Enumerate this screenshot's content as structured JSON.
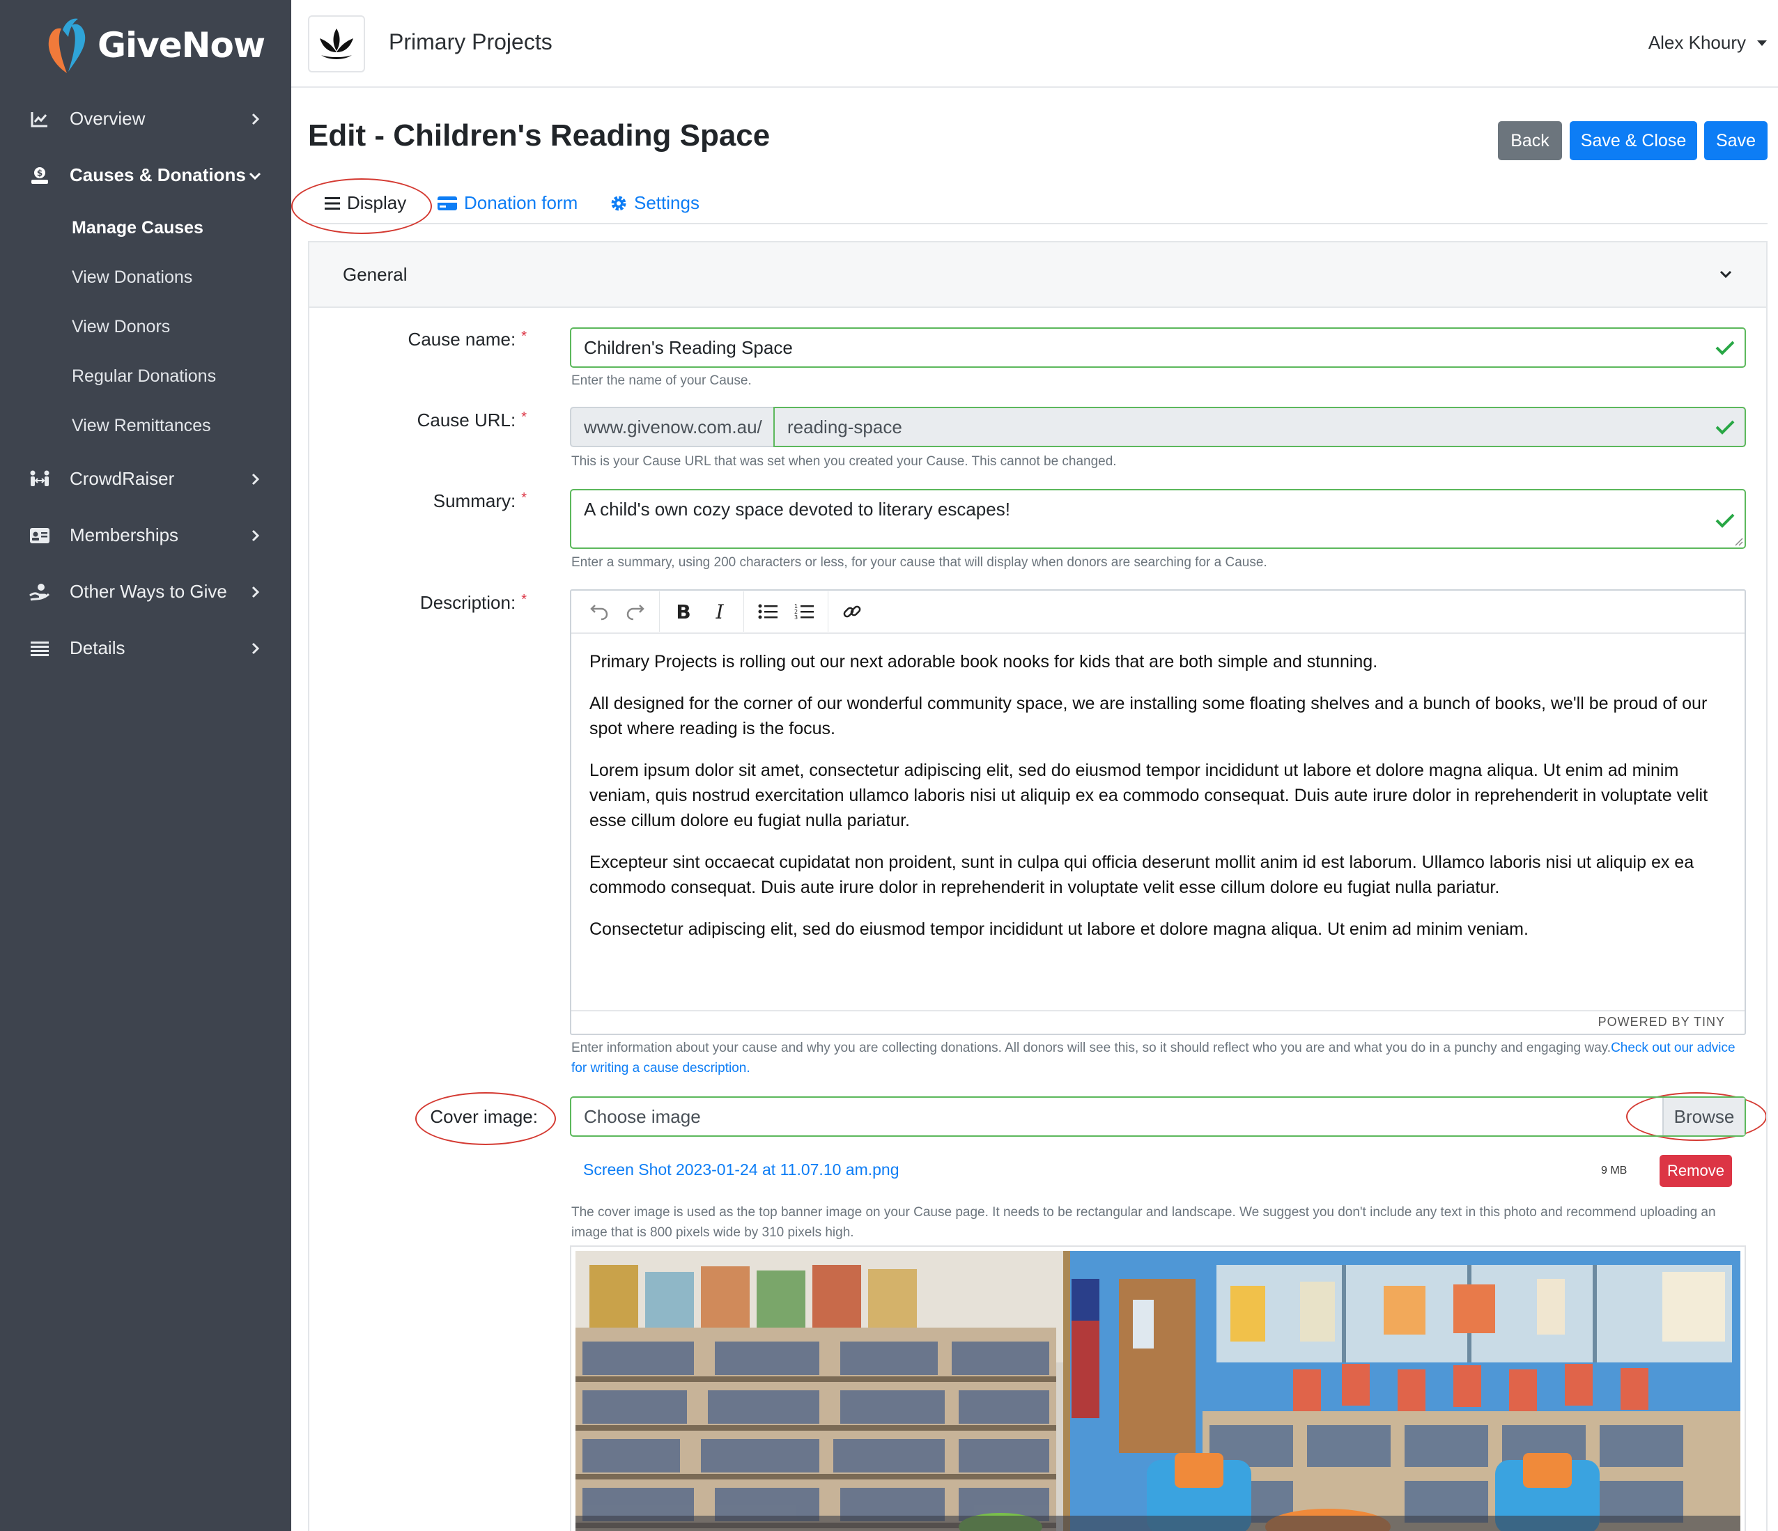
{
  "brand": {
    "name": "GiveNow",
    "accent": "#0d7df5",
    "sidebar_bg": "#3e444e"
  },
  "sidebar": {
    "items": [
      {
        "label": "Overview",
        "icon": "chart-line-icon"
      },
      {
        "label": "Causes & Donations",
        "icon": "donate-hand-icon",
        "expanded": true
      },
      {
        "label": "CrowdRaiser",
        "icon": "people-arrows-icon"
      },
      {
        "label": "Memberships",
        "icon": "id-card-icon"
      },
      {
        "label": "Other Ways to Give",
        "icon": "hand-holding-icon"
      },
      {
        "label": "Details",
        "icon": "list-icon"
      }
    ],
    "subitems": [
      "Manage Causes",
      "View Donations",
      "View Donors",
      "Regular Donations",
      "View Remittances"
    ]
  },
  "header": {
    "org_name": "Primary Projects",
    "user_name": "Alex Khoury"
  },
  "page": {
    "title": "Edit - Children's Reading Space",
    "buttons": {
      "back": "Back",
      "save_close": "Save & Close",
      "save": "Save"
    },
    "tabs": [
      "Display",
      "Donation form",
      "Settings"
    ]
  },
  "panel": {
    "title": "General",
    "cause_name": {
      "label": "Cause name:",
      "value": "Children's Reading Space",
      "help": "Enter the name of your Cause."
    },
    "cause_url": {
      "label": "Cause URL:",
      "prefix": "www.givenow.com.au/",
      "value": "reading-space",
      "help": "This is your Cause URL that was set when you created your Cause. This cannot be changed."
    },
    "summary": {
      "label": "Summary:",
      "value": "A child's own cozy space devoted to literary escapes!",
      "help": "Enter a summary, using 200 characters or less, for your cause that will display when donors are searching for a Cause."
    },
    "description": {
      "label": "Description:",
      "paragraphs": [
        "Primary Projects is rolling out our next adorable book nooks for kids that are both simple and stunning.",
        "All designed for the corner of our wonderful community space, we are installing some floating shelves and a bunch of books, we'll be proud of our spot where reading is the focus.",
        "Lorem ipsum dolor sit amet, consectetur adipiscing elit, sed do eiusmod tempor incididunt ut labore et dolore magna aliqua. Ut enim ad minim veniam, quis nostrud exercitation ullamco laboris nisi ut aliquip ex ea commodo consequat. Duis aute irure dolor in reprehenderit in voluptate velit esse cillum dolore eu fugiat nulla pariatur.",
        "Excepteur sint occaecat cupidatat non proident, sunt in culpa qui officia deserunt mollit anim id est laborum. Ullamco laboris nisi ut aliquip ex ea commodo consequat. Duis aute irure dolor in reprehenderit in voluptate velit esse cillum dolore eu fugiat nulla pariatur.",
        "Consectetur adipiscing elit, sed do eiusmod tempor incididunt ut labore et dolore magna aliqua. Ut enim ad minim veniam."
      ],
      "powered_by": "POWERED BY TINY",
      "help": "Enter information about your cause and why you are collecting donations. All donors will see this, so it should reflect who you are and what you do in a punchy and engaging way.",
      "help_link": "Check out our advice for writing a cause description."
    },
    "cover_image": {
      "label": "Cover image:",
      "placeholder": "Choose image",
      "browse": "Browse",
      "file_name": "Screen Shot 2023-01-24 at 11.07.10 am.png",
      "file_size": "9 MB",
      "remove": "Remove",
      "help": "The cover image is used as the top banner image on your Cause page. It needs to be rectangular and landscape. We suggest you don't include any text in this photo and recommend uploading an image that is 800 pixels wide by 310 pixels high."
    }
  },
  "colors": {
    "valid_border": "#5cb85c",
    "danger": "#dc3545",
    "secondary": "#6c757d",
    "annotation": "#d43a32"
  }
}
